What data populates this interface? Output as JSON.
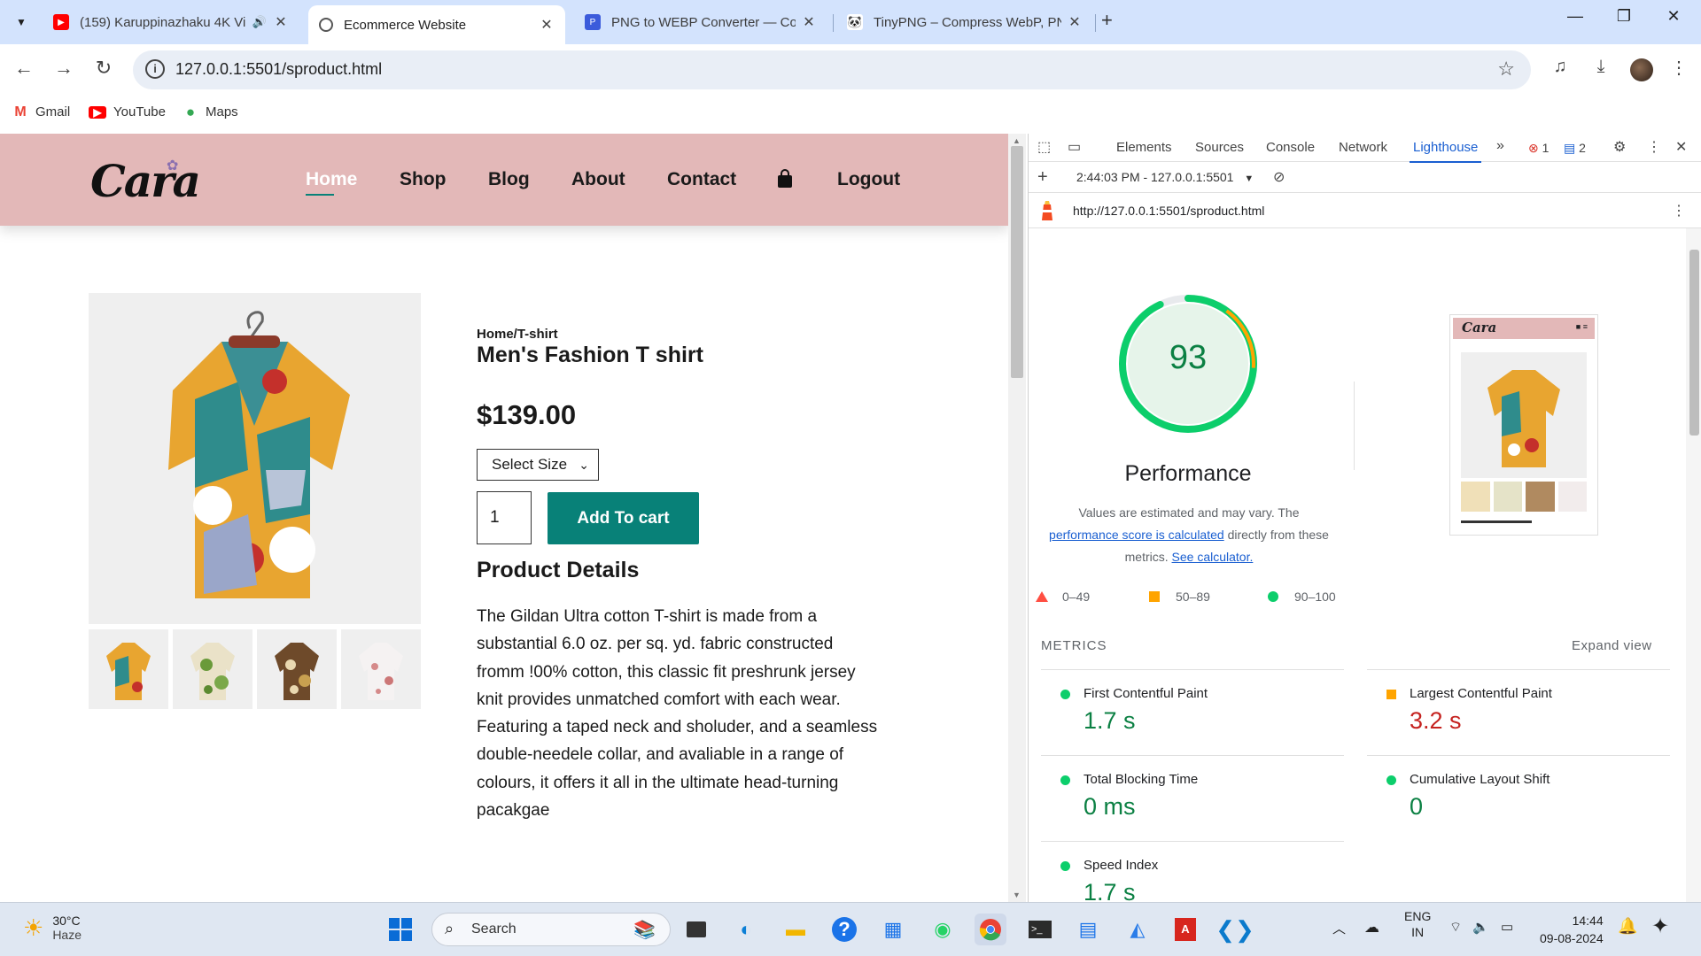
{
  "browser": {
    "tabs": [
      {
        "title": "(159) Karuppinazhaku 4K Vi",
        "favicon": "youtube-icon",
        "color": "#ff0000"
      },
      {
        "title": "Ecommerce Website",
        "favicon": "globe-icon",
        "color": "#555555"
      },
      {
        "title": "PNG to WEBP Converter — Con",
        "favicon": "converter-icon",
        "color": "#3b5bdb"
      },
      {
        "title": "TinyPNG – Compress WebP, PN",
        "favicon": "panda-icon",
        "color": "#222222"
      }
    ],
    "url": "127.0.0.1:5501/sproduct.html",
    "bookmarks": [
      {
        "label": "Gmail",
        "icon": "gmail-icon"
      },
      {
        "label": "YouTube",
        "icon": "youtube-icon"
      },
      {
        "label": "Maps",
        "icon": "maps-icon"
      }
    ]
  },
  "site": {
    "logo": "Cara",
    "nav": [
      "Home",
      "Shop",
      "Blog",
      "About",
      "Contact",
      "Logout"
    ],
    "breadcrumb": "Home/T-shirt",
    "product_title": "Men's Fashion T shirt",
    "price": "$139.00",
    "size_select": "Select Size",
    "quantity": "1",
    "add_to_cart": "Add To cart",
    "details_heading": "Product Details",
    "details_text": "The Gildan Ultra cotton T-shirt is made from a substantial 6.0 oz. per sq. yd. fabric constructed fromm !00% cotton, this classic fit preshrunk jersey knit provides unmatched comfort with each wear. Featuring a taped neck and sholuder, and a seamless double-needele collar, and avaliable in a range of colours, it offers it all in the ultimate head-turning pacakgae",
    "brand_color": "#088178",
    "header_color": "#e3b8b8"
  },
  "devtools": {
    "tabs": [
      "Elements",
      "Sources",
      "Console",
      "Network",
      "Lighthouse"
    ],
    "active_tab": "Lighthouse",
    "error_count": "1",
    "message_count": "2",
    "report_label": "2:44:03 PM - 127.0.0.1:5501",
    "report_url": "http://127.0.0.1:5501/sproduct.html",
    "score": "93",
    "score_fraction": 0.93,
    "category": "Performance",
    "note_before": "Values are estimated and may vary. The",
    "note_link": "performance score is calculated",
    "note_after": "directly from these metrics.",
    "note_link2": "See calculator.",
    "legend": [
      "0–49",
      "50–89",
      "90–100"
    ],
    "metrics_heading": "METRICS",
    "expand_label": "Expand view",
    "metrics": [
      {
        "label": "First Contentful Paint",
        "value": "1.7 s",
        "status": "good"
      },
      {
        "label": "Largest Contentful Paint",
        "value": "3.2 s",
        "status": "average"
      },
      {
        "label": "Total Blocking Time",
        "value": "0 ms",
        "status": "good"
      },
      {
        "label": "Cumulative Layout Shift",
        "value": "0",
        "status": "good"
      },
      {
        "label": "Speed Index",
        "value": "1.7 s",
        "status": "good"
      }
    ]
  },
  "taskbar": {
    "temperature": "30°C",
    "condition": "Haze",
    "search_placeholder": "Search",
    "lang_top": "ENG",
    "lang_bottom": "IN",
    "time": "14:44",
    "date": "09-08-2024"
  }
}
